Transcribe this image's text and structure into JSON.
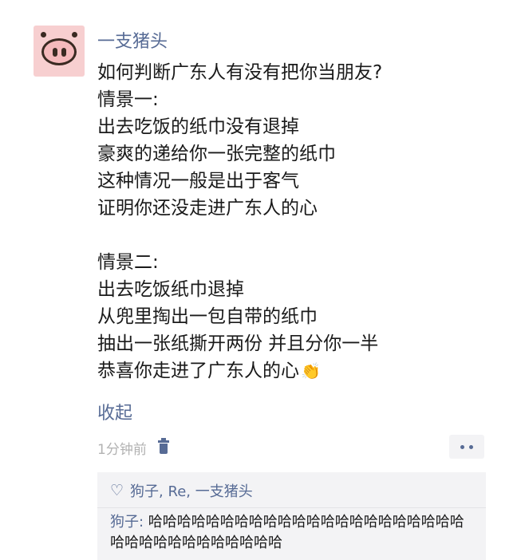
{
  "post": {
    "author": "一支猪头",
    "lines": [
      "如何判断广东人有没有把你当朋友?",
      "情景一:",
      "出去吃饭的纸巾没有退掉",
      "豪爽的递给你一张完整的纸巾",
      "这种情况一般是出于客气",
      "证明你还没走进广东人的心",
      "",
      "情景二:",
      "出去吃饭纸巾退掉",
      "从兜里掏出一包自带的纸巾",
      "抽出一张纸撕开两份 并且分你一半",
      "恭喜你走进了广东人的心"
    ],
    "emoji": "👏",
    "collapse_label": "收起",
    "timestamp": "1分钟前"
  },
  "likes": {
    "names": "狗子, Re, 一支猪头"
  },
  "comment": {
    "author": "狗子",
    "separator": ": ",
    "text": "哈哈哈哈哈哈哈哈哈哈哈哈哈哈哈哈哈哈哈哈哈哈哈哈哈哈哈哈哈哈哈哈哈哈"
  },
  "icons": {
    "avatar": "pig-snout-avatar",
    "delete": "trash-icon",
    "more": "more-dots-icon",
    "like": "heart-icon"
  },
  "colors": {
    "link": "#576b95",
    "timestamp": "#b2b2b2",
    "comment_bg": "#f3f3f5"
  }
}
